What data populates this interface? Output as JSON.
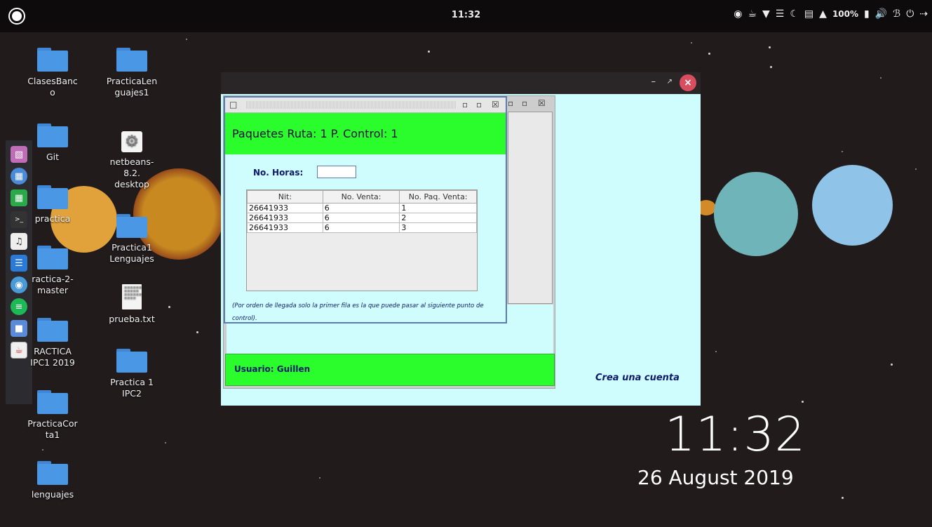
{
  "topbar": {
    "clock": "11:32",
    "battery": "100%"
  },
  "desktop_icons": [
    {
      "label": "ClasesBanc\no",
      "type": "folder"
    },
    {
      "label": "PracticaLen\nguajes1",
      "type": "folder"
    },
    {
      "label": "Git",
      "type": "folder"
    },
    {
      "label": "netbeans-\n8.2.\ndesktop",
      "type": "launcher"
    },
    {
      "label": "practica",
      "type": "folder"
    },
    {
      "label": "Practica1\nLenguajes",
      "type": "folder"
    },
    {
      "label": "ractica-2-\nmaster",
      "type": "folder"
    },
    {
      "label": "prueba.txt",
      "type": "text-file"
    },
    {
      "label": "RACTICA\nIPC1 2019",
      "type": "folder"
    },
    {
      "label": "Practica 1\nIPC2",
      "type": "folder"
    },
    {
      "label": "PracticaCor\nta1",
      "type": "folder"
    },
    {
      "label": "lenguajes",
      "type": "folder"
    }
  ],
  "big_window": {
    "link_label": "Crea una cuenta"
  },
  "back_frame": {
    "footer_label": "Usuario: Guillen"
  },
  "front_frame": {
    "header_title": "Paquetes Ruta: 1  P. Control: 1",
    "horas_label": "No. Horas:",
    "horas_value": "",
    "table": {
      "headers": [
        "Nit:",
        "No. Venta:",
        "No. Paq. Venta:"
      ],
      "rows": [
        [
          "26641933",
          "6",
          "1"
        ],
        [
          "26641933",
          "6",
          "2"
        ],
        [
          "26641933",
          "6",
          "3"
        ]
      ]
    },
    "note": "(Por orden de llegada solo la primer fila es la que puede pasar al siguiente punto de control)."
  },
  "desktop_clock": {
    "time": "11:32",
    "date": "26 August 2019"
  }
}
